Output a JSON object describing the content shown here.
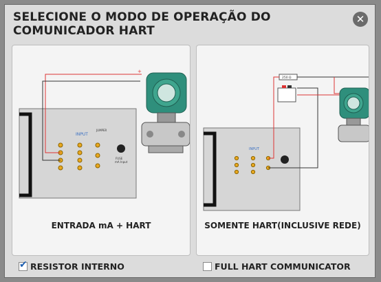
{
  "dialog": {
    "title": "SELECIONE O MODO DE OPERAÇÃO DO COMUNICADOR HART",
    "close_icon": "close-circle-icon"
  },
  "options": [
    {
      "label": "ENTRADA mA + HART"
    },
    {
      "label": "SOMENTE HART(INCLUSIVE REDE)"
    }
  ],
  "panel_text": {
    "input": "INPUT",
    "jumper": "JUMPER",
    "fuse": "FUSE mA Input",
    "resistor_box": "250 Ω"
  },
  "checkboxes": [
    {
      "label": "RESISTOR INTERNO",
      "checked": true
    },
    {
      "label": "FULL HART COMMUNICATOR",
      "checked": false
    }
  ],
  "colors": {
    "transmitter_green": "#2f8f7c",
    "wire_red": "#d33",
    "wire_dark": "#333",
    "panel_gray": "#d4d4d4"
  }
}
